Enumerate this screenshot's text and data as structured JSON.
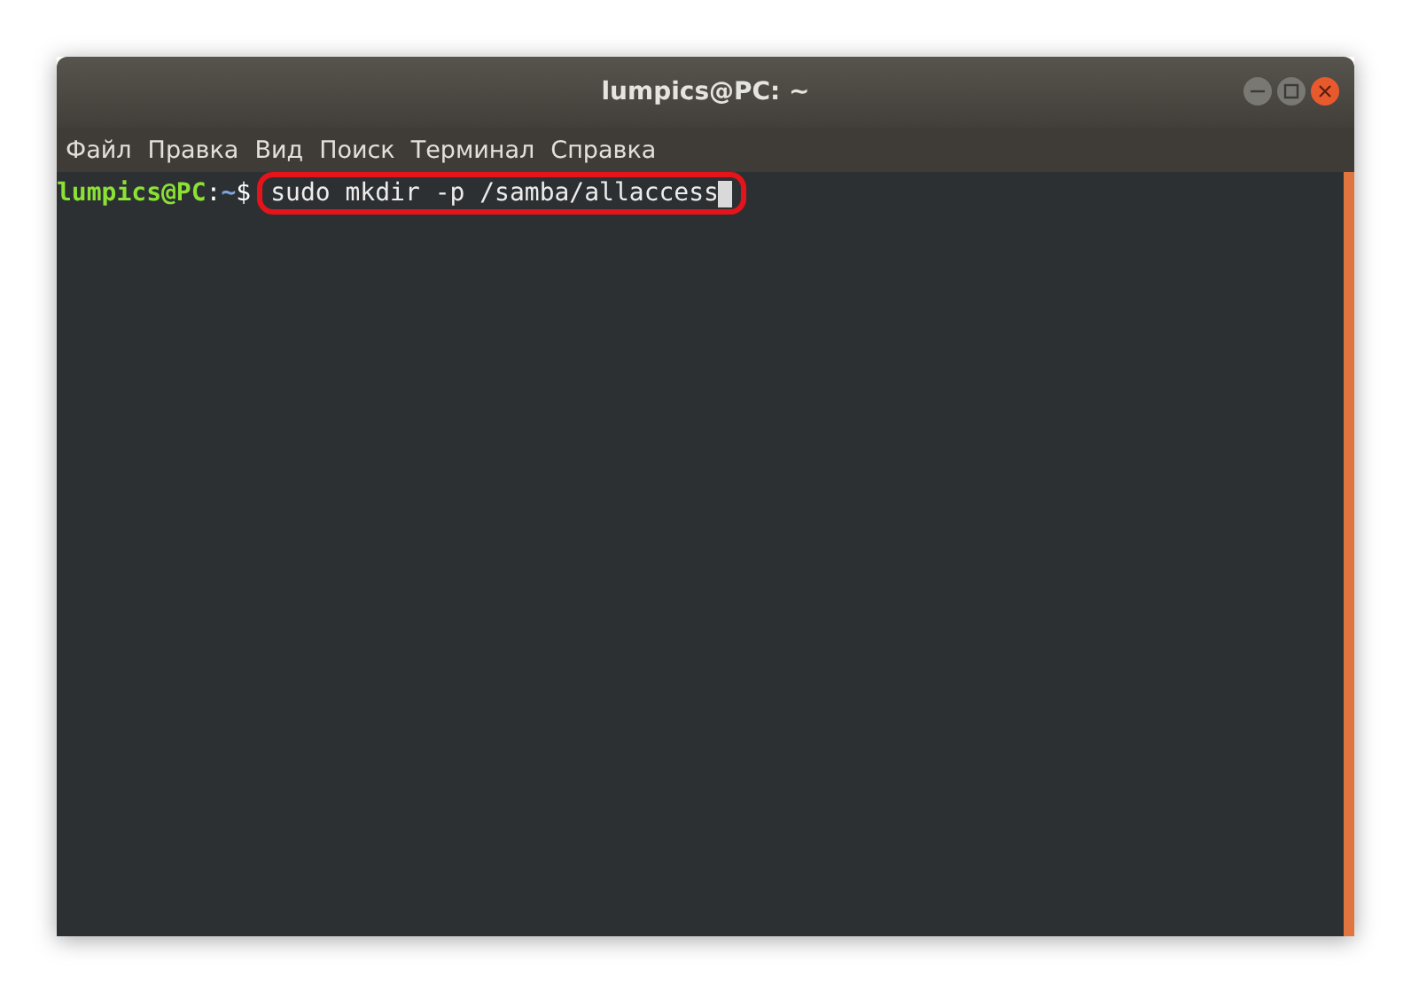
{
  "window": {
    "title": "lumpics@PC: ~"
  },
  "menu": [
    "Файл",
    "Правка",
    "Вид",
    "Поиск",
    "Терминал",
    "Справка"
  ],
  "terminal": {
    "user_host": "lumpics@PC",
    "separator": ":",
    "path": "~",
    "prompt": "$",
    "command": "sudo mkdir -p /samba/allaccess",
    "command_highlighted": true
  }
}
